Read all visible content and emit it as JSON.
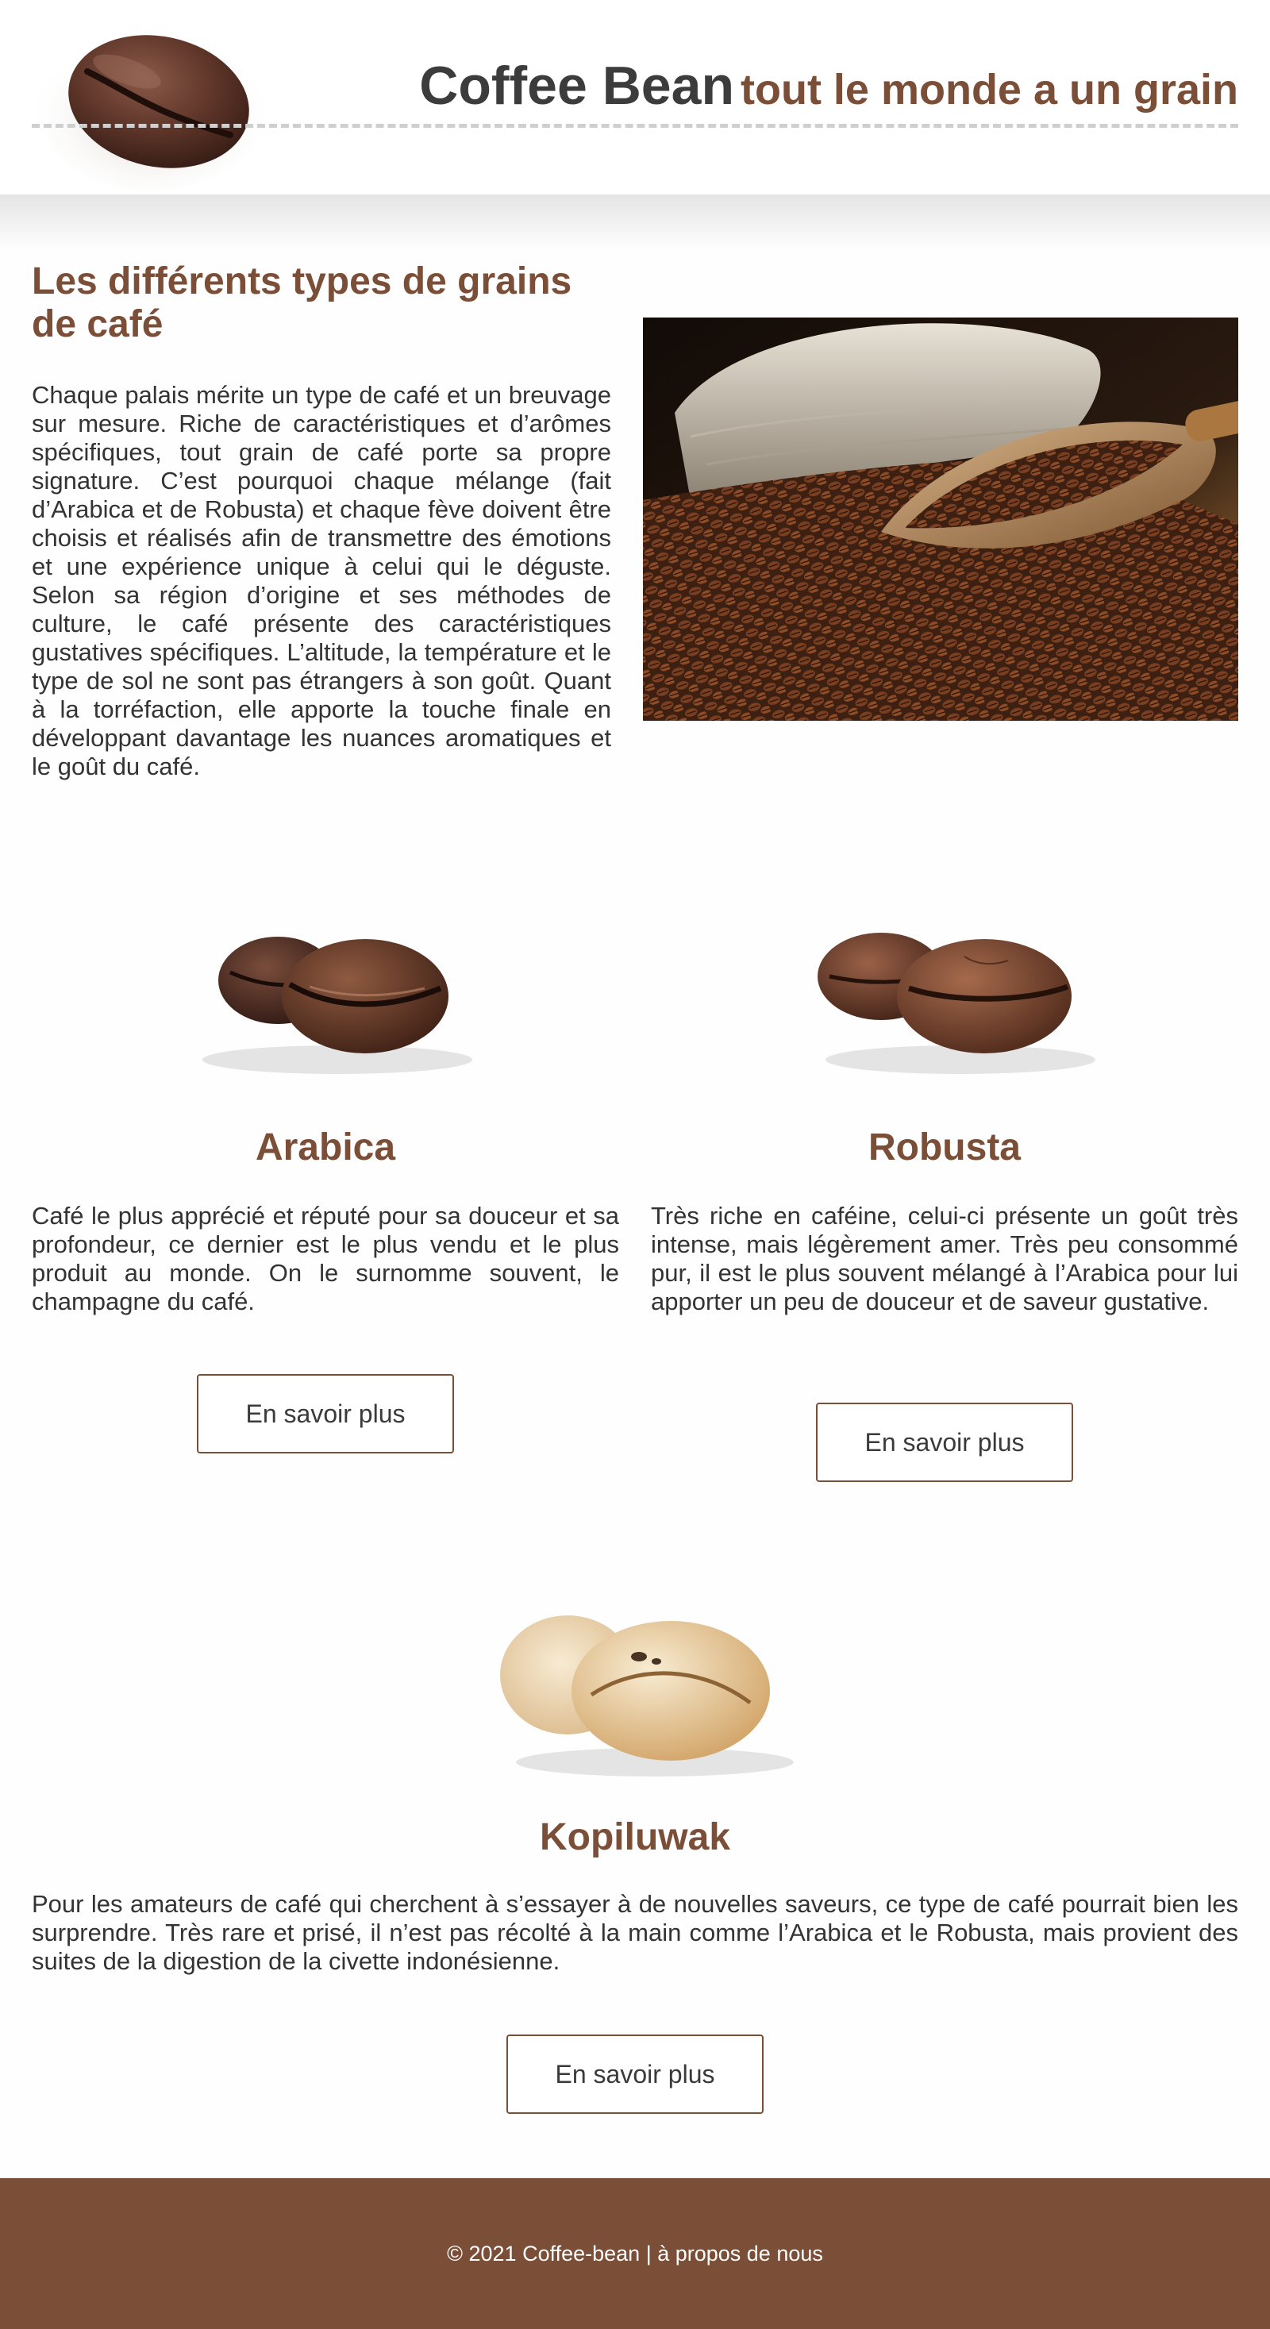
{
  "header": {
    "title": "Coffee Bean",
    "tagline": "tout le monde a un grain"
  },
  "intro": {
    "heading": "Les différents types de grains de café",
    "text": "Chaque palais mérite un type de café et un breuvage sur mesure. Riche de caractéristiques et d’arômes spécifiques, tout grain de café porte sa propre signature. C’est pourquoi chaque mélange (fait d’Arabica et de Robusta) et chaque fève doivent être choisis et réalisés afin de transmettre des émotions et une expérience unique à celui qui le déguste. Selon sa région d’origine et ses méthodes de culture, le café présente des caractéristiques gustatives spécifiques. L’altitude, la température et le type de sol ne sont pas étrangers à son goût. Quant à la torréfaction, elle apporte la touche finale en développant davantage les nuances aromatiques et le goût du café."
  },
  "cards": [
    {
      "title": "Arabica",
      "text": "Café le plus apprécié et réputé pour sa douceur et sa profondeur, ce dernier est le plus vendu et le plus produit au monde. On le surnomme souvent, le champagne du café.",
      "button": "En savoir plus"
    },
    {
      "title": "Robusta",
      "text": "Très riche en caféine, celui-ci présente un goût très intense, mais légèrement amer. Très peu consommé pur, il est le plus souvent mélangé à l’Arabica pour lui apporter un peu de douceur et de saveur gustative.",
      "button": "En savoir plus"
    },
    {
      "title": "Kopiluwak",
      "text": "Pour les amateurs de café qui cherchent à s’essayer à de nouvelles saveurs, ce type de café pourrait bien les surprendre. Très rare et prisé, il n’est pas récolté à la main comme l’Arabica et le Robusta, mais provient des suites de la digestion de la civette indonésienne.",
      "button": "En savoir plus"
    }
  ],
  "footer": {
    "text": "© 2021 Coffee-bean | à propos de nous"
  },
  "colors": {
    "accent": "#7b4e37",
    "text": "#3a3a3a",
    "footer_bg": "#7b4e37"
  },
  "icons": {
    "logo": "coffee-bean-logo",
    "hero": "coffee-beans-scoop-photo",
    "arabica": "roasted-beans-image",
    "robusta": "roasted-beans-image",
    "kopiluwak": "green-beans-image"
  }
}
